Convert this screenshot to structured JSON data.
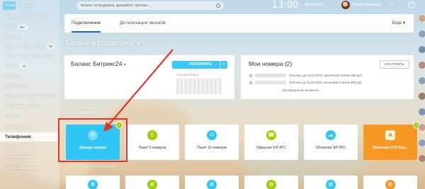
{
  "topbar": {
    "search_placeholder": "искать сотрудника, документ, прочее...",
    "time": "13:00",
    "start_label": "НАЧАТЬ",
    "user_name": "Юлия Травкина",
    "help_icon": "?"
  },
  "sidebar": {
    "items": [
      {
        "label": "Живая лента",
        "badge": ""
      },
      {
        "label": "Заявки от клиентов",
        "badge": ""
      },
      {
        "label": "CRM",
        "badge": "99+"
      },
      {
        "label": "Сделки",
        "badge": ""
      },
      {
        "label": "Задачи и Проекты",
        "badge": "29"
      },
      {
        "label": "Внедрение Битрикс24",
        "badge": ""
      },
      {
        "label": "Почта",
        "badge": "43"
      },
      {
        "label": "Группы",
        "badge": ""
      },
      {
        "label": "Календарь",
        "badge": ""
      },
      {
        "label": "Отдел по работе с парт...",
        "badge": ""
      },
      {
        "label": "CRM-маркетинг",
        "badge": ""
      },
      {
        "label": "Сайты",
        "badge": ""
      },
      {
        "label": "Сотрудники",
        "badge": ""
      },
      {
        "label": "Телефония",
        "badge": ""
      },
      {
        "label": "Диск",
        "badge": ""
      },
      {
        "label": "Приложения",
        "badge": ""
      },
      {
        "label": "CRM-аналитика",
        "badge": ""
      }
    ],
    "active_index": 13
  },
  "tabs": {
    "items": [
      "Подключение",
      "Детализация звонков"
    ],
    "active": 0,
    "more": "Еще"
  },
  "balance_section": {
    "title": "Баланс и статистика",
    "balance_card_title": "Баланс Битрикс24",
    "topup_button": "ПОПОЛНИТЬ",
    "current_balance_label": "Текущий баланс"
  },
  "numbers_card": {
    "title": "Мои номера (2)",
    "settings_button": "НАСТРОИТЬ",
    "rows": [
      "Оплачен до 23.01.2020, месячный платеж 295 руб.",
      "Оплачен до 11.02.2020, месячный платеж 390 руб."
    ],
    "autorenew": "Автопродление включено"
  },
  "telephony": {
    "title": "Телефония",
    "tiles": [
      {
        "label": "Аренда номера",
        "icon": "phone-number-icon",
        "icon_glyph": "✆",
        "color": "#2fc6f6"
      },
      {
        "label": "Пакет 5 номеров",
        "icon": "package-5-icon",
        "icon_glyph": "5",
        "color": "#9dcf00"
      },
      {
        "label": "Пакет 10 номеров",
        "icon": "package-10-icon",
        "icon_glyph": "10",
        "color": "#2fc6f6"
      },
      {
        "label": "Офисная SIP АТС",
        "icon": "office-sip-icon",
        "icon_glyph": "☎",
        "color": "#9dcf00"
      },
      {
        "label": "Облачная SIP АТС",
        "icon": "cloud-sip-icon",
        "icon_glyph": "☁",
        "color": "#2fc6f6"
      },
      {
        "label": "Облачная АТС Биз...",
        "icon": "cloud-pbx-icon",
        "icon_glyph": "■",
        "color": "#f79825"
      }
    ]
  },
  "settings_section": {
    "title": "Настройки телефонии"
  }
}
